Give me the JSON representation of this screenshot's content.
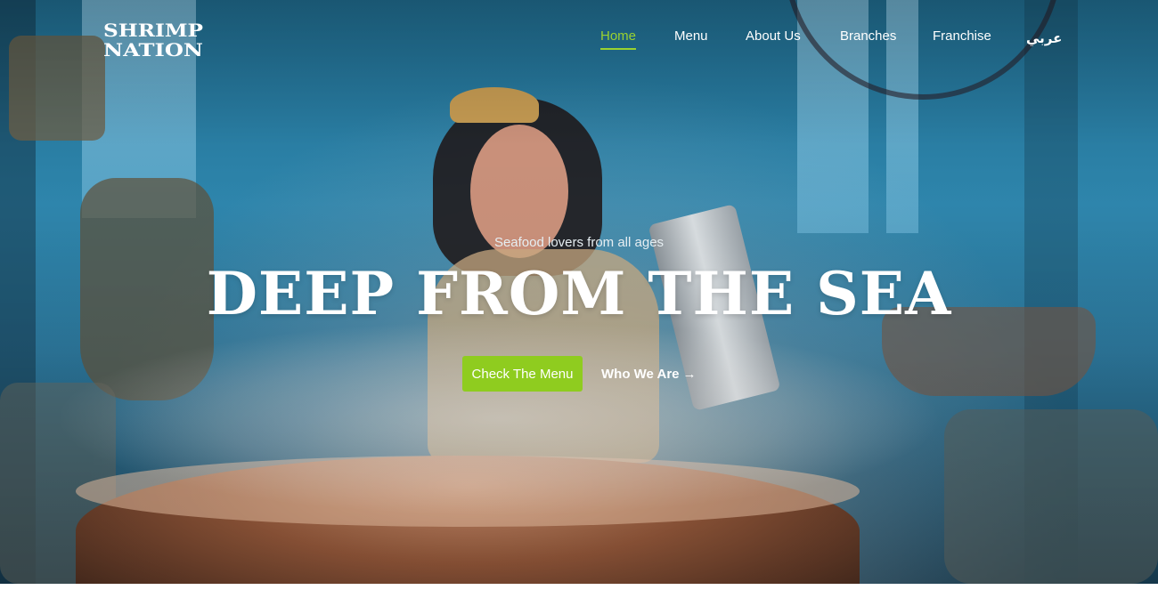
{
  "brand": {
    "logo_line1": "SHRIMP",
    "logo_line2": "NATION"
  },
  "nav": {
    "items": [
      {
        "label": "Home",
        "active": true
      },
      {
        "label": "Menu"
      },
      {
        "label": "About Us"
      },
      {
        "label": "Branches"
      },
      {
        "label": "Franchise"
      }
    ],
    "language": "عربي"
  },
  "hero": {
    "tagline": "Seafood lovers from all ages",
    "headline": "DEEP FROM THE SEA",
    "primary_cta": "Check The Menu",
    "secondary_cta": "Who We Are",
    "secondary_icon": "arrow-right-icon",
    "background": "video-still"
  },
  "colors": {
    "accent": "#8fcc1f",
    "active_nav": "#9ad230",
    "text": "#ffffff"
  }
}
